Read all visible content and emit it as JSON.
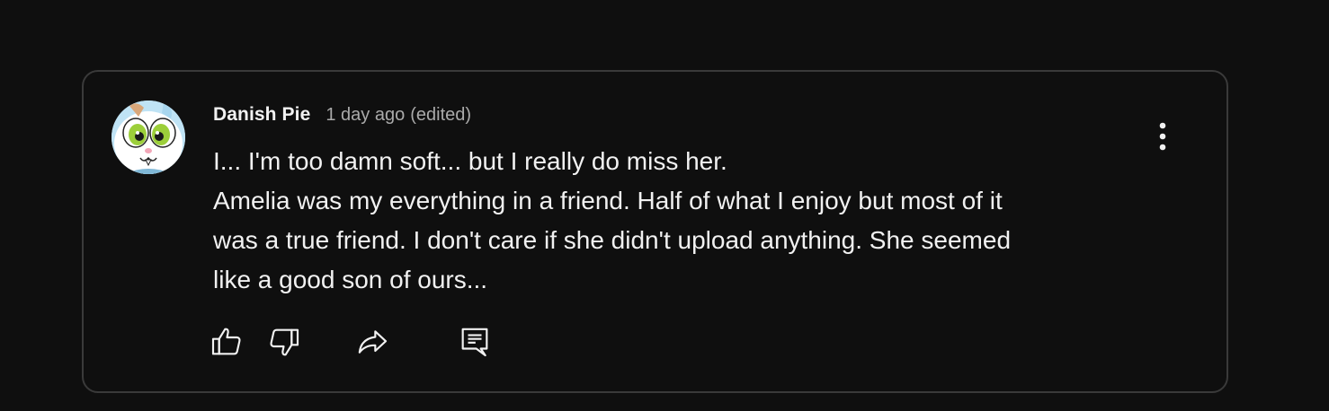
{
  "comment": {
    "author": "Danish Pie",
    "timestamp": "1 day ago",
    "edited": "(edited)",
    "text_lines": [
      "I... I'm too damn soft... but I really do miss her.",
      "Amelia was my everything in a friend. Half of what I enjoy but most of it",
      "was a true friend. I don't care if she didn't upload anything. She seemed",
      "like a good son of ours..."
    ],
    "avatar": {
      "icon": "cartoon-bunny-avatar"
    }
  },
  "actions": {
    "like": {
      "icon": "thumbs-up-icon"
    },
    "dislike": {
      "icon": "thumbs-down-icon"
    },
    "share": {
      "icon": "share-arrow-icon"
    },
    "reply": {
      "icon": "reply-comment-icon"
    },
    "more": {
      "icon": "more-vertical-icon"
    }
  },
  "colors": {
    "background": "#0f0f0f",
    "border": "#3a3a3a",
    "text_primary": "#f1f1f1",
    "text_secondary": "#aaaaaa"
  }
}
